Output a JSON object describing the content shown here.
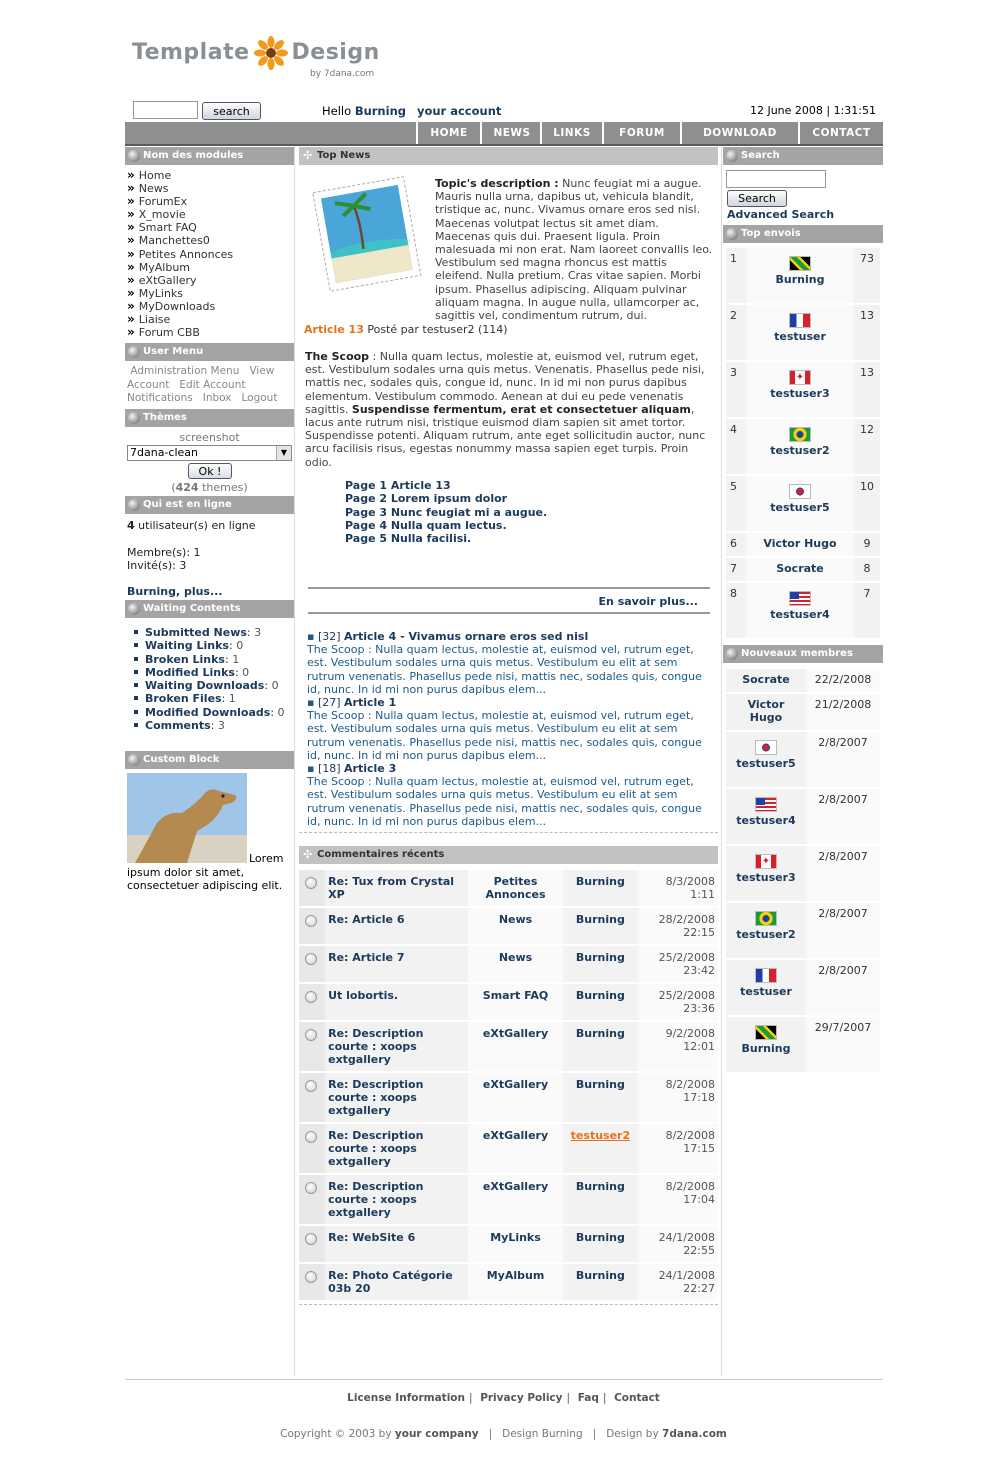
{
  "header": {
    "logo_text_1": "Template",
    "logo_text_2": "Design",
    "logo_by": "by 7dana.com",
    "search_button": "search",
    "hello": "Hello",
    "user": "Burning",
    "your_account": "your account",
    "datetime": "12 June 2008 | 1:31:51"
  },
  "nav": [
    "HOME",
    "NEWS",
    "LINKS",
    "FORUM",
    "DOWNLOAD",
    "CONTACT"
  ],
  "left": {
    "modules_title": "Nom des modules",
    "modules": [
      "Home",
      "News",
      "ForumEx",
      "X_movie",
      "Smart FAQ",
      "Manchettes0",
      "Petites Annonces",
      "MyAlbum",
      "eXtGallery",
      "MyLinks",
      "MyDownloads",
      "Liaise",
      "Forum CBB"
    ],
    "usermenu_title": "User Menu",
    "usermenu": [
      "Administration Menu",
      "View Account",
      "Edit Account",
      "Notifications",
      "Inbox",
      "Logout"
    ],
    "themes_title": "Thèmes",
    "themes_screenshot": "screenshot",
    "theme_selected": "7dana-clean",
    "themes_ok": "Ok !",
    "themes_count": "424",
    "themes_word": "themes",
    "online_title": "Qui est en ligne",
    "online_count": "4",
    "online_text": "utilisateur(s) en ligne",
    "members": "Membre(s): 1",
    "guests": "Invité(s): 3",
    "online_more": "Burning, plus...",
    "waiting_title": "Waiting Contents",
    "waiting": [
      {
        "label": "Submitted News",
        "count": "3"
      },
      {
        "label": "Waiting Links",
        "count": "0"
      },
      {
        "label": "Broken Links",
        "count": "1"
      },
      {
        "label": "Modified Links",
        "count": "0"
      },
      {
        "label": "Waiting Downloads",
        "count": "0"
      },
      {
        "label": "Broken Files",
        "count": "1"
      },
      {
        "label": "Modified Downloads",
        "count": "0"
      },
      {
        "label": "Comments",
        "count": "3"
      }
    ],
    "custom_title": "Custom Block",
    "custom_text": "Lorem ipsum dolor sit amet, consectetuer adipiscing elit."
  },
  "center": {
    "topnews_title": "Top News",
    "topic_label": "Topic's description :",
    "topic_text": "Nunc feugiat mi a augue. Mauris nulla urna, dapibus ut, vehicula blandit, tristique ac, nunc. Vivamus ornare eros sed nisl. Maecenas volutpat lectus sit amet diam. Maecenas quis dui. Praesent ligula. Proin malesuada mi non erat. Nam laoreet convallis leo. Vestibulum sed magna rhoncus est mattis eleifend. Nulla pretium. Cras vitae sapien. Morbi ipsum. Phasellus adipiscing. Aliquam pulvinar aliquam magna. In augue nulla, ullamcorper ac, sagittis vel, condimentum rutrum, dui.",
    "article_link": "Article 13",
    "article_posted": "Posté par testuser2 (114)",
    "scoop_label": "The Scoop",
    "scoop_text_1": ": Nulla quam lectus, molestie at, euismod vel, rutrum eget, est. Vestibulum sodales urna quis metus. Venenatis. Phasellus pede nisi, mattis nec, sodales quis, congue id, nunc. In id mi non purus dapibus elementum. Vestibulum commodo. Aenean at dui eu pede venenatis sagittis.",
    "scoop_bold": "Suspendisse fermentum, erat et consectetuer aliquam",
    "scoop_text_2": ", lacus ante rutrum nisi, tristique euismod diam sapien sit amet tortor. Suspendisse potenti. Aliquam rutrum, ante eget sollicitudin auctor, nunc arcu facilisis risus, egestas nonummy massa sapien eget turpis. Proin odio.",
    "pages": [
      "Page 1 Article 13",
      "Page 2 Lorem ipsum dolor",
      "Page 3 Nunc feugiat mi a augue.",
      "Page 4 Nulla quam lectus.",
      "Page 5 Nulla facilisi."
    ],
    "more": "En savoir plus...",
    "news": [
      {
        "count": "[32]",
        "title": "Article 4 - Vivamus ornare eros sed nisl",
        "text": "The Scoop : Nulla quam lectus, molestie at, euismod vel, rutrum eget, est. Vestibulum sodales urna quis metus. Vestibulum eu elit at sem rutrum venenatis. Phasellus pede nisi, mattis nec, sodales quis, congue id, nunc. In id mi non purus dapibus elem..."
      },
      {
        "count": "[27]",
        "title": "Article 1",
        "text": "The Scoop : Nulla quam lectus, molestie at, euismod vel, rutrum eget, est. Vestibulum sodales urna quis metus. Vestibulum eu elit at sem rutrum venenatis. Phasellus pede nisi, mattis nec, sodales quis, congue id, nunc. In id mi non purus dapibus elem..."
      },
      {
        "count": "[18]",
        "title": "Article 3",
        "text": "The Scoop : Nulla quam lectus, molestie at, euismod vel, rutrum eget, est. Vestibulum sodales urna quis metus. Vestibulum eu elit at sem rutrum venenatis. Phasellus pede nisi, mattis nec, sodales quis, congue id, nunc. In id mi non purus dapibus elem..."
      }
    ],
    "comments_title": "Commentaires récents",
    "comments": [
      {
        "title": "Re: Tux from Crystal XP",
        "module": "Petites Annonces",
        "poster": "Burning",
        "date": "8/3/2008 1:11"
      },
      {
        "title": "Re: Article 6",
        "module": "News",
        "poster": "Burning",
        "date": "28/2/2008 22:15"
      },
      {
        "title": "Re: Article 7",
        "module": "News",
        "poster": "Burning",
        "date": "25/2/2008 23:42"
      },
      {
        "title": "Ut lobortis.",
        "module": "Smart FAQ",
        "poster": "Burning",
        "date": "25/2/2008 23:36"
      },
      {
        "title": "Re: Description courte : xoops extgallery",
        "module": "eXtGallery",
        "poster": "Burning",
        "date": "9/2/2008 12:01"
      },
      {
        "title": "Re: Description courte : xoops extgallery",
        "module": "eXtGallery",
        "poster": "Burning",
        "date": "8/2/2008 17:18"
      },
      {
        "title": "Re: Description courte : xoops extgallery",
        "module": "eXtGallery",
        "poster": "testuser2",
        "date": "8/2/2008 17:15"
      },
      {
        "title": "Re: Description courte : xoops extgallery",
        "module": "eXtGallery",
        "poster": "Burning",
        "date": "8/2/2008 17:04"
      },
      {
        "title": "Re: WebSite 6",
        "module": "MyLinks",
        "poster": "Burning",
        "date": "24/1/2008 22:55"
      },
      {
        "title": "Re: Photo Catégorie 03b 20",
        "module": "MyAlbum",
        "poster": "Burning",
        "date": "24/1/2008 22:27"
      }
    ]
  },
  "right": {
    "search_title": "Search",
    "search_button": "Search",
    "advanced": "Advanced Search",
    "top_title": "Top envois",
    "top": [
      {
        "rank": "1",
        "name": "Burning",
        "count": "73",
        "flag": "jamaica"
      },
      {
        "rank": "2",
        "name": "testuser",
        "count": "13",
        "flag": "france"
      },
      {
        "rank": "3",
        "name": "testuser3",
        "count": "13",
        "flag": "canada"
      },
      {
        "rank": "4",
        "name": "testuser2",
        "count": "12",
        "flag": "brazil"
      },
      {
        "rank": "5",
        "name": "testuser5",
        "count": "10",
        "flag": "korea"
      },
      {
        "rank": "6",
        "name": "Victor Hugo",
        "count": "9",
        "flag": ""
      },
      {
        "rank": "7",
        "name": "Socrate",
        "count": "8",
        "flag": ""
      },
      {
        "rank": "8",
        "name": "testuser4",
        "count": "7",
        "flag": "usa"
      }
    ],
    "new_title": "Nouveaux membres",
    "new_members": [
      {
        "name": "Socrate",
        "date": "22/2/2008",
        "flag": ""
      },
      {
        "name": "Victor Hugo",
        "date": "21/2/2008",
        "flag": ""
      },
      {
        "name": "testuser5",
        "date": "2/8/2007",
        "flag": "korea"
      },
      {
        "name": "testuser4",
        "date": "2/8/2007",
        "flag": "usa"
      },
      {
        "name": "testuser3",
        "date": "2/8/2007",
        "flag": "canada"
      },
      {
        "name": "testuser2",
        "date": "2/8/2007",
        "flag": "brazil"
      },
      {
        "name": "testuser",
        "date": "2/8/2007",
        "flag": "france"
      },
      {
        "name": "Burning",
        "date": "29/7/2007",
        "flag": "jamaica"
      }
    ]
  },
  "footer": {
    "links": [
      "License Information",
      "Privacy Policy",
      "Faq",
      "Contact"
    ],
    "copyright_pre": "Copyright © 2003 by",
    "company": "your company",
    "design_burning": "Design Burning",
    "design_by": "Design by",
    "dana": "7dana.com"
  }
}
